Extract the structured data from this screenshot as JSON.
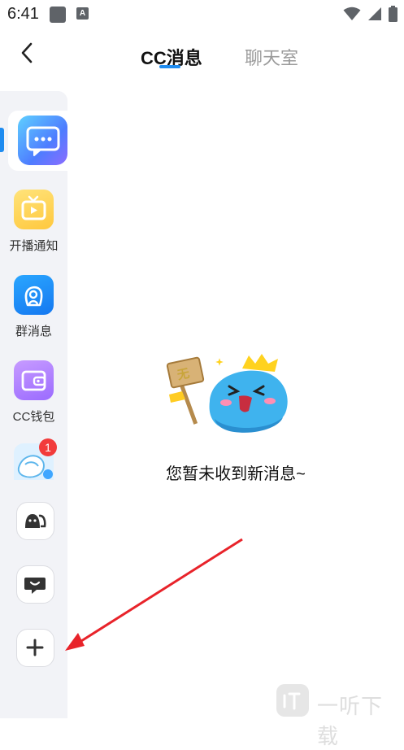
{
  "status_bar": {
    "time": "6:41",
    "notif_letter": "A"
  },
  "header": {
    "tabs": [
      {
        "label": "CC消息",
        "active": true
      },
      {
        "label": "聊天室",
        "active": false
      }
    ],
    "accent_color": "#1f8cf0"
  },
  "sidebar": {
    "items": [
      {
        "label": "",
        "icon": "message-dots-icon",
        "selected": true
      },
      {
        "label": "开播通知",
        "icon": "tv-icon"
      },
      {
        "label": "群消息",
        "icon": "group-icon"
      },
      {
        "label": "CC钱包",
        "icon": "wallet-icon"
      },
      {
        "label": "",
        "icon": "avatar-thumbnail",
        "badge": "1"
      }
    ],
    "bottom_buttons": [
      {
        "icon": "users-icon"
      },
      {
        "icon": "smile-chat-icon"
      },
      {
        "icon": "plus-icon"
      }
    ]
  },
  "empty_state": {
    "sign_text": "无",
    "message": "您暂未收到新消息~"
  },
  "watermark": {
    "text": "一听下载"
  }
}
